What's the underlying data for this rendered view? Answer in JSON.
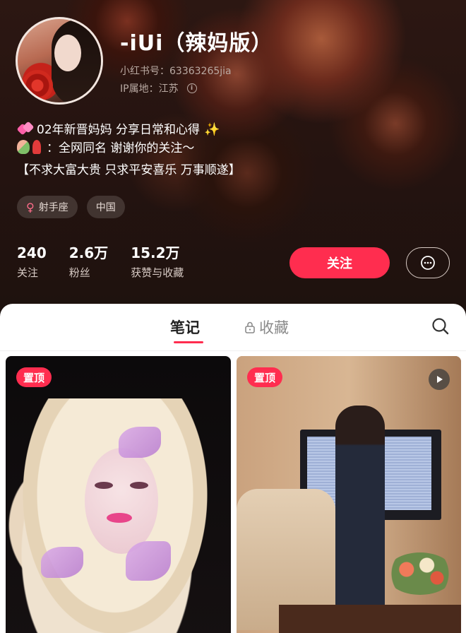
{
  "profile": {
    "name": "-iUi（辣妈版）",
    "xhs_id": "小红书号：63363265jia",
    "ip_location": "IP属地：江苏",
    "bio_line1": "02年新晋妈妈 分享日常和心得",
    "bio_line2": "：全网同名 谢谢你的关注～",
    "bio_line3": "【不求大富大贵 只求平安喜乐 万事顺遂】"
  },
  "tags": [
    {
      "label": "射手座",
      "icon": "female-icon"
    },
    {
      "label": "中国"
    }
  ],
  "stats": [
    {
      "value": "240",
      "label": "关注"
    },
    {
      "value": "2.6万",
      "label": "粉丝"
    },
    {
      "value": "15.2万",
      "label": "获赞与收藏"
    }
  ],
  "actions": {
    "follow_label": "关注",
    "message_icon": "chat-bubble-icon"
  },
  "tabs": {
    "notes_label": "笔记",
    "collect_label": "收藏",
    "collect_icon": "lock-icon",
    "search_icon": "search-icon"
  },
  "cards": [
    {
      "badge": "置顶",
      "has_video": false
    },
    {
      "badge": "置顶",
      "has_video": true
    }
  ],
  "colors": {
    "accent": "#ff2d4f",
    "header_bg": "#241310"
  }
}
